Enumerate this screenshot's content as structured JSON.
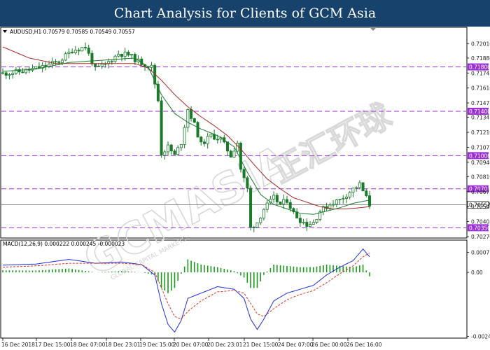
{
  "header": {
    "title": "Chart Analysis for Clients of GCM Asia"
  },
  "price_panel": {
    "info_text": "AUDUSD,H1  0.70579 0.70585 0.70549 0.70557"
  },
  "macd_panel": {
    "label": "MACD(12,26,9) 0.000222 0.000245 -0.000023"
  },
  "watermark": {
    "text": "GCMASIA",
    "sub": "GLOBAL CAPITAL MARKETS",
    "chinese": "正汇环球"
  },
  "colors": {
    "header": "#16426b",
    "candle": "#1a7a2a",
    "sma_fast": "#1a7a2a",
    "sma_slow": "#a52a2a",
    "level_line": "#9b30d9",
    "current_price_line": "#8c8c8c",
    "macd_line": "#1f2fd8",
    "signal_line": "#e03020",
    "histogram": "#1a9a1a"
  },
  "chart_data": {
    "type": "candlestick",
    "symbol": "AUDUSD",
    "timeframe": "H1",
    "ylim": [
      0.7027,
      0.72075
    ],
    "y_ticks": [
      "0.72010",
      "0.71880",
      "0.71745",
      "0.71610",
      "0.71475",
      "0.71345",
      "0.71210",
      "0.71075",
      "0.70940",
      "0.70810",
      "0.70675",
      "0.70540",
      "0.70405",
      "0.70270"
    ],
    "x_ticks": [
      "16 Dec 2018",
      "17 Dec 15:00",
      "18 Dec 07:00",
      "18 Dec 23:01",
      "19 Dec 15:00",
      "20 Dec 07:00",
      "20 Dec 23:01",
      "21 Dec 15:00",
      "24 Dec 07:00",
      "26 Dec 00:00",
      "26 Dec 16:00"
    ],
    "levels": [
      {
        "label": "0.71800",
        "value": 0.718
      },
      {
        "label": "0.71400",
        "value": 0.714
      },
      {
        "label": "0.71000",
        "value": 0.71
      },
      {
        "label": "0.70701",
        "value": 0.70701
      },
      {
        "label": "0.70350",
        "value": 0.7035
      }
    ],
    "current_price": {
      "label": "0.70557",
      "value": 0.70557
    },
    "close_path": [
      [
        0,
        0.7174
      ],
      [
        6,
        0.7176
      ],
      [
        12,
        0.718
      ],
      [
        17,
        0.7185
      ],
      [
        21,
        0.7195
      ],
      [
        25,
        0.7198
      ],
      [
        28,
        0.7178
      ],
      [
        31,
        0.7182
      ],
      [
        35,
        0.7192
      ],
      [
        38,
        0.7191
      ],
      [
        41,
        0.7185
      ],
      [
        45,
        0.718
      ],
      [
        47,
        0.715
      ],
      [
        48,
        0.7102
      ],
      [
        50,
        0.7108
      ],
      [
        52,
        0.71
      ],
      [
        54,
        0.7112
      ],
      [
        56,
        0.7142
      ],
      [
        58,
        0.7128
      ],
      [
        60,
        0.711
      ],
      [
        63,
        0.7118
      ],
      [
        66,
        0.7115
      ],
      [
        69,
        0.71
      ],
      [
        71,
        0.7112
      ],
      [
        72,
        0.7088
      ],
      [
        74,
        0.707
      ],
      [
        75,
        0.7035
      ],
      [
        77,
        0.704
      ],
      [
        79,
        0.7052
      ],
      [
        82,
        0.7062
      ],
      [
        84,
        0.7056
      ],
      [
        86,
        0.706
      ],
      [
        88,
        0.7048
      ],
      [
        90,
        0.7042
      ],
      [
        92,
        0.7038
      ],
      [
        94,
        0.704
      ],
      [
        96,
        0.705
      ],
      [
        98,
        0.7054
      ],
      [
        100,
        0.7058
      ],
      [
        102,
        0.706
      ],
      [
        104,
        0.7065
      ],
      [
        106,
        0.707
      ],
      [
        108,
        0.7074
      ],
      [
        110,
        0.7062
      ],
      [
        111,
        0.70557
      ]
    ],
    "sma_fast_path": [
      [
        0,
        0.7176
      ],
      [
        10,
        0.7178
      ],
      [
        20,
        0.7184
      ],
      [
        30,
        0.7186
      ],
      [
        40,
        0.7188
      ],
      [
        44,
        0.718
      ],
      [
        48,
        0.7155
      ],
      [
        52,
        0.7138
      ],
      [
        56,
        0.713
      ],
      [
        60,
        0.7124
      ],
      [
        65,
        0.7118
      ],
      [
        70,
        0.7108
      ],
      [
        74,
        0.7085
      ],
      [
        78,
        0.7065
      ],
      [
        82,
        0.7056
      ],
      [
        86,
        0.7052
      ],
      [
        90,
        0.7048
      ],
      [
        94,
        0.7047
      ],
      [
        98,
        0.705
      ],
      [
        102,
        0.7053
      ],
      [
        106,
        0.7057
      ],
      [
        111,
        0.706
      ]
    ],
    "sma_slow_path": [
      [
        0,
        0.7198
      ],
      [
        8,
        0.7188
      ],
      [
        16,
        0.7183
      ],
      [
        24,
        0.7183
      ],
      [
        32,
        0.7183
      ],
      [
        40,
        0.7183
      ],
      [
        44,
        0.7179
      ],
      [
        48,
        0.7168
      ],
      [
        52,
        0.7155
      ],
      [
        56,
        0.7144
      ],
      [
        60,
        0.7135
      ],
      [
        64,
        0.7127
      ],
      [
        68,
        0.7118
      ],
      [
        72,
        0.7106
      ],
      [
        76,
        0.7092
      ],
      [
        80,
        0.7079
      ],
      [
        84,
        0.707
      ],
      [
        88,
        0.7062
      ],
      [
        92,
        0.7058
      ],
      [
        96,
        0.7054
      ],
      [
        100,
        0.7052
      ],
      [
        104,
        0.7052
      ],
      [
        108,
        0.7053
      ],
      [
        111,
        0.7054
      ]
    ],
    "macd": {
      "ylim": [
        -0.00245,
        0.001
      ],
      "y_ticks": [
        {
          "label": "0.000775",
          "value": 0.000775
        },
        {
          "label": "0.00",
          "value": 0.0
        },
        {
          "label": "-0.002459",
          "value": -0.002459
        }
      ],
      "macd_path": [
        [
          0,
          0.00028
        ],
        [
          10,
          0.00032
        ],
        [
          20,
          0.0005
        ],
        [
          28,
          0.00035
        ],
        [
          36,
          0.0004
        ],
        [
          42,
          0.0003
        ],
        [
          46,
          -0.0001
        ],
        [
          48,
          -0.0012
        ],
        [
          50,
          -0.002
        ],
        [
          52,
          -0.0023
        ],
        [
          54,
          -0.00185
        ],
        [
          56,
          -0.001
        ],
        [
          60,
          -0.0008
        ],
        [
          65,
          -0.00055
        ],
        [
          70,
          -0.00065
        ],
        [
          73,
          -0.001
        ],
        [
          75,
          -0.0018
        ],
        [
          77,
          -0.0022
        ],
        [
          79,
          -0.0018
        ],
        [
          82,
          -0.0011
        ],
        [
          86,
          -0.0008
        ],
        [
          90,
          -0.00065
        ],
        [
          94,
          -0.0005
        ],
        [
          98,
          -0.0001
        ],
        [
          102,
          0.0002
        ],
        [
          106,
          0.00045
        ],
        [
          109,
          0.0009
        ],
        [
          111,
          0.0006
        ]
      ],
      "signal_path": [
        [
          0,
          0.0002
        ],
        [
          10,
          0.00025
        ],
        [
          20,
          0.00035
        ],
        [
          28,
          0.00035
        ],
        [
          36,
          0.00035
        ],
        [
          42,
          0.0003
        ],
        [
          46,
          0.0
        ],
        [
          48,
          -0.0006
        ],
        [
          50,
          -0.0012
        ],
        [
          52,
          -0.0017
        ],
        [
          54,
          -0.0018
        ],
        [
          56,
          -0.0015
        ],
        [
          60,
          -0.0011
        ],
        [
          65,
          -0.00075
        ],
        [
          70,
          -0.0007
        ],
        [
          73,
          -0.0008
        ],
        [
          75,
          -0.0012
        ],
        [
          77,
          -0.0016
        ],
        [
          79,
          -0.0017
        ],
        [
          82,
          -0.0014
        ],
        [
          86,
          -0.00105
        ],
        [
          90,
          -0.00085
        ],
        [
          94,
          -0.0007
        ],
        [
          98,
          -0.0004
        ],
        [
          102,
          -5e-05
        ],
        [
          106,
          0.00025
        ],
        [
          109,
          0.0006
        ],
        [
          111,
          0.00075
        ]
      ]
    }
  }
}
